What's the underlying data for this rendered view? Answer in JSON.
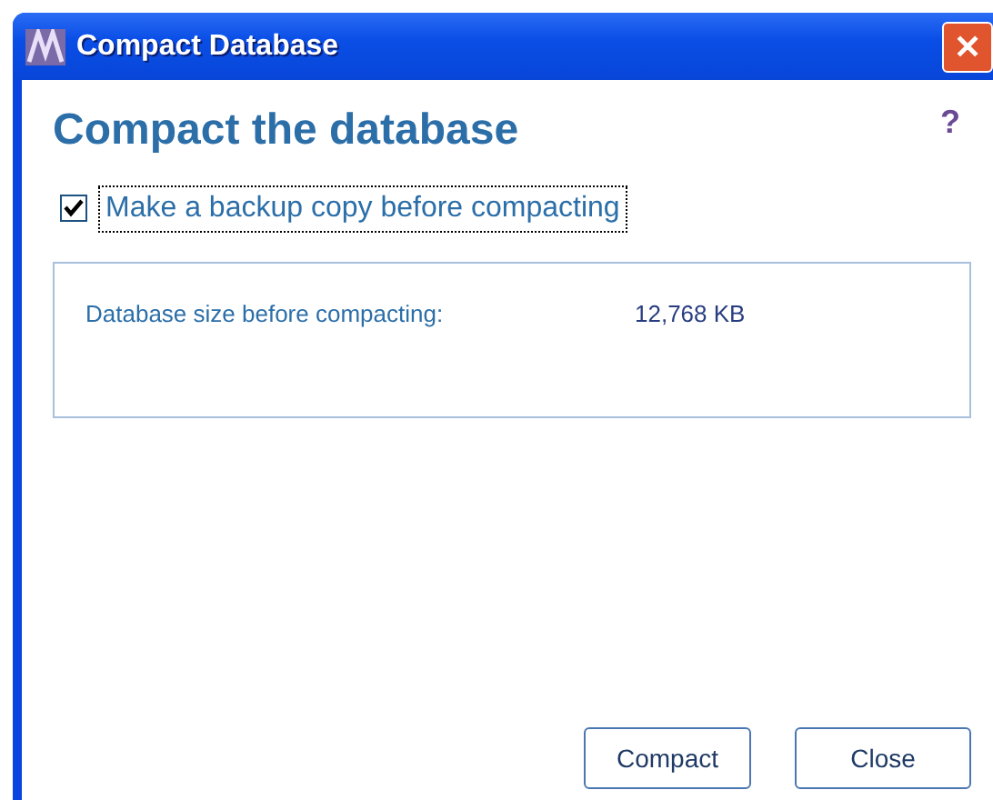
{
  "window": {
    "title": "Compact Database",
    "close_glyph": "✕"
  },
  "help": "?",
  "heading": "Compact the database",
  "backup": {
    "label": "Make a backup copy before compacting",
    "checked": true
  },
  "info": {
    "label": "Database size before compacting:",
    "value": "12,768 KB"
  },
  "buttons": [
    "Compact",
    "Close"
  ]
}
